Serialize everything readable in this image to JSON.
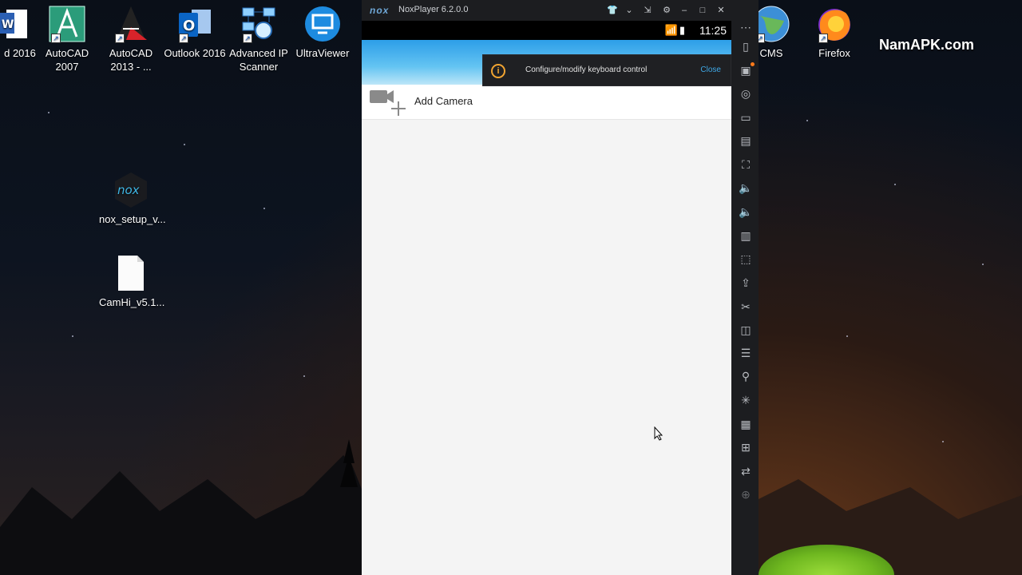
{
  "desktop": {
    "watermark": "NamAPK.com",
    "icons": [
      {
        "label": "d 2016",
        "icon": "word-icon"
      },
      {
        "label": "AutoCAD\n2007",
        "icon": "autocad-2007-icon"
      },
      {
        "label": "AutoCAD\n2013 - ...",
        "icon": "autocad-2013-icon"
      },
      {
        "label": "Outlook 2016",
        "icon": "outlook-icon"
      },
      {
        "label": "Advanced IP\nScanner",
        "icon": "advanced-ip-scanner-icon"
      },
      {
        "label": "UltraViewer",
        "icon": "ultraviewer-icon"
      },
      {
        "label": "CMS",
        "icon": "cms-globe-icon"
      },
      {
        "label": "Firefox",
        "icon": "firefox-icon"
      },
      {
        "label": "nox_setup_v...",
        "icon": "nox-icon"
      },
      {
        "label": "CamHi_v5.1...",
        "icon": "file-icon"
      }
    ]
  },
  "nox": {
    "logo": "nox",
    "title": "NoxPlayer 6.2.0.0",
    "status_time": "11:25",
    "notification": {
      "text": "Configure/modify keyboard control",
      "close_label": "Close"
    },
    "app": {
      "add_camera_label": "Add Camera"
    }
  },
  "colors": {
    "appbar": "#2d9ee8",
    "toast_accent": "#f1a431",
    "link": "#3fa8e6"
  }
}
